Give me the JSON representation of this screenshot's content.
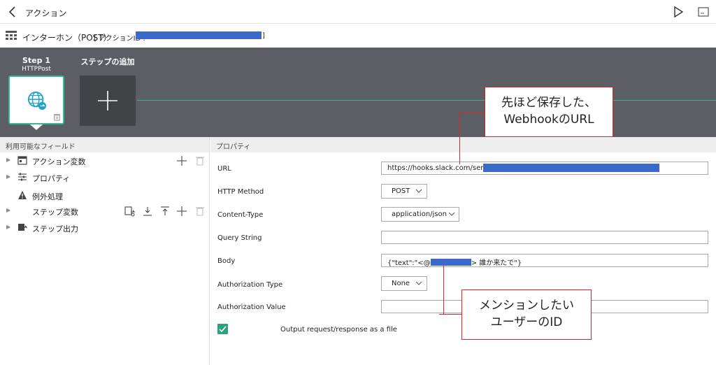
{
  "topbar": {
    "title": "アクション",
    "back_icon": "chevron-left-icon",
    "run_icon": "play-icon",
    "console_icon": "console-icon"
  },
  "subbar": {
    "action_name": "インターホン（POST）",
    "action_id_label": "[ アクションID :",
    "action_id_close": "]"
  },
  "steps": {
    "step1_title": "Step 1",
    "step1_subtitle": "HTTPPost",
    "add_step_label": "ステップの追加",
    "step_icon": "globe-arrow-icon",
    "delete_icon": "trash-icon",
    "add_icon": "plus-icon"
  },
  "left_pane": {
    "header": "利用可能なフィールド",
    "items": [
      {
        "label": "アクション変数",
        "icon": "calendar-icon"
      },
      {
        "label": "プロパティ",
        "icon": "sliders-icon"
      },
      {
        "label": "例外処理",
        "icon": "warning-icon"
      },
      {
        "label": "ステップ変数",
        "icon": ""
      },
      {
        "label": "ステップ出力",
        "icon": "output-icon"
      }
    ]
  },
  "right_pane": {
    "header": "プロパティ",
    "fields": {
      "url_label": "URL",
      "url_value": "https://hooks.slack.com/services",
      "method_label": "HTTP Method",
      "method_value": "POST",
      "content_type_label": "Content-Type",
      "content_type_value": "application/json",
      "query_label": "Query String",
      "query_value": "",
      "body_label": "Body",
      "body_value_prefix": "{\"text\":\"<@",
      "body_value_suffix": "> 誰か来たで\"}",
      "auth_type_label": "Authorization Type",
      "auth_type_value": "None",
      "auth_value_label": "Authorization Value",
      "auth_value_value": "",
      "output_file_label": "Output request/response as a file",
      "output_file_checked": true
    }
  },
  "callouts": {
    "webhook_line1": "先ほど保存した、",
    "webhook_line2": "WebhookのURL",
    "mention_line1": "メンションしたい",
    "mention_line2": "ユーザーのID"
  },
  "colors": {
    "accent": "#2fa27b",
    "step_border": "#39b796",
    "stepbar_bg": "#5b5f64",
    "redaction": "#3a69c8",
    "callout_border": "#d9252b"
  }
}
